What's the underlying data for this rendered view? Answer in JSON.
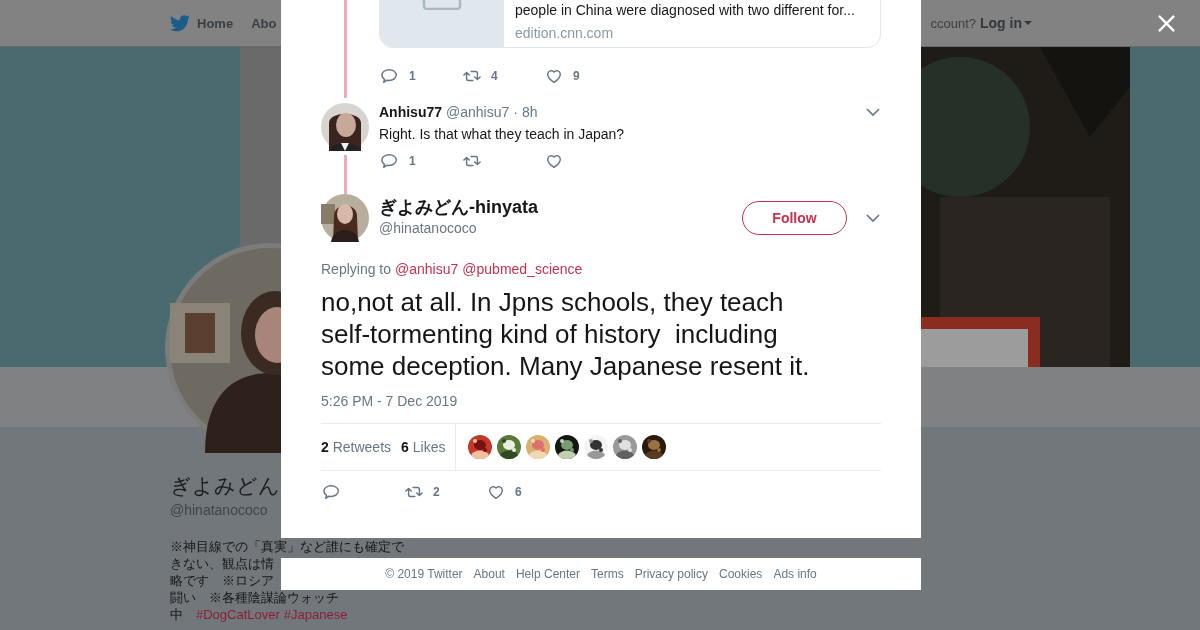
{
  "background": {
    "header": {
      "nav_items": [
        "Home",
        "Abo"
      ],
      "account_prompt": "ccount?",
      "login_link": "Log in"
    },
    "profile": {
      "name": "ぎよみどん",
      "handle": "@hinatanococo",
      "bio_lines": [
        "※神目線での「真実」など誰にも確定で",
        "きない、観点は情",
        "略です　※ロシア",
        "闘い　※各種陰謀論ウォッチ"
      ],
      "bio_tail": "中",
      "hashtags": [
        "#DogCatLover",
        "#Japanese"
      ]
    }
  },
  "modal": {
    "link_card": {
      "title": "people in China were diagnosed with two different for...",
      "domain": "edition.cnn.com"
    },
    "parent_actions": [
      {
        "kind": "reply",
        "count": "1"
      },
      {
        "kind": "retweet",
        "count": "4"
      },
      {
        "kind": "like",
        "count": "9"
      }
    ],
    "reply_tweet": {
      "name": "Anhisu77",
      "handle": "@anhisu7",
      "separator": "·",
      "time": "8h",
      "text": "Right. Is that what they teach in Japan?",
      "actions": [
        {
          "kind": "reply",
          "count": "1"
        },
        {
          "kind": "retweet"
        },
        {
          "kind": "like"
        }
      ]
    },
    "main_tweet": {
      "name": "ぎよみどん-hinyata",
      "handle": "@hinatanococo",
      "follow_label": "Follow",
      "replying_to_label": "Replying to",
      "replying_to": [
        "@anhisu7",
        "@pubmed_science"
      ],
      "text": "no,not at all. In Jpns schools, they teach self-tormenting kind of history  including some deception. Many Japanese resent it.",
      "timestamp": "5:26 PM - 7 Dec 2019",
      "retweet_count": "2",
      "retweet_label": "Retweets",
      "like_count": "6",
      "like_label": "Likes",
      "likers": [
        {
          "kind": "picture"
        },
        {
          "kind": "picture"
        },
        {
          "kind": "picture"
        },
        {
          "kind": "picture"
        },
        {
          "kind": "picture"
        },
        {
          "kind": "picture"
        },
        {
          "kind": "picture"
        }
      ],
      "actions": [
        {
          "kind": "reply"
        },
        {
          "kind": "retweet",
          "count": "2"
        },
        {
          "kind": "like",
          "count": "6"
        }
      ]
    }
  },
  "footer_links": [
    "© 2019 Twitter",
    "About",
    "Help Center",
    "Terms",
    "Privacy policy",
    "Cookies",
    "Ads info"
  ]
}
